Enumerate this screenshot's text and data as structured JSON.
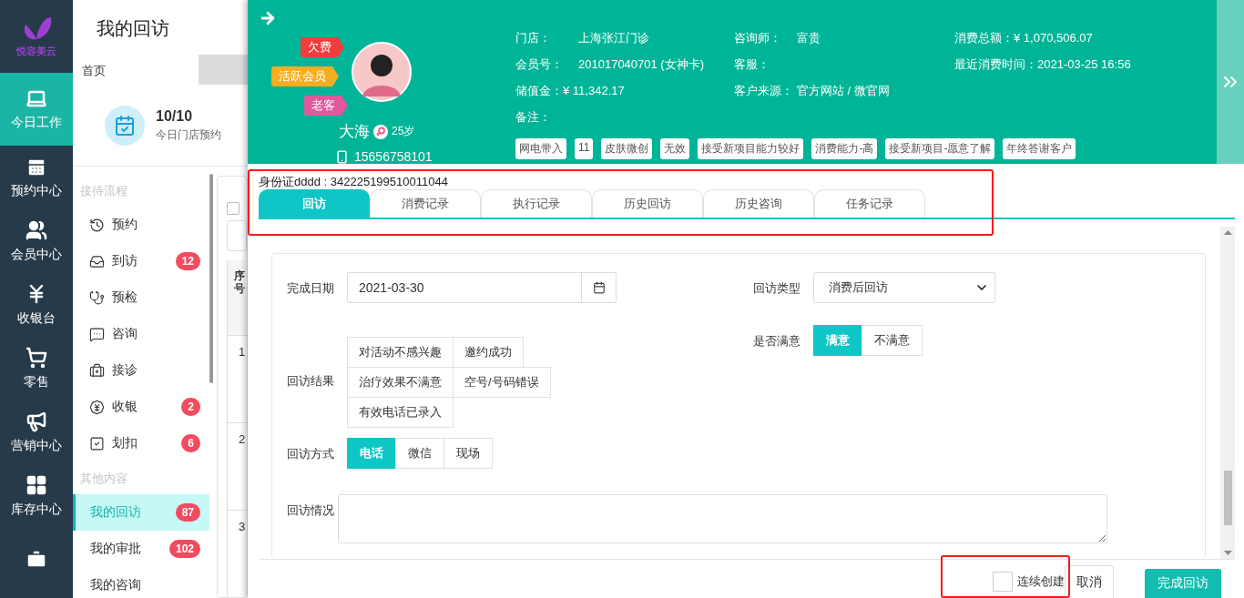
{
  "brand": {
    "name": "悦容美云"
  },
  "nav_rail": [
    {
      "label": "今日工作",
      "selected": true
    },
    {
      "label": "预约中心",
      "selected": false
    },
    {
      "label": "会员中心",
      "selected": false
    },
    {
      "label": "收银台",
      "selected": false
    },
    {
      "label": "零售",
      "selected": false
    },
    {
      "label": "营销中心",
      "selected": false
    },
    {
      "label": "库存中心",
      "selected": false
    },
    {
      "selected": false
    }
  ],
  "page_title": "我的回访",
  "page_tabs": [
    {
      "label": "首页",
      "selected": true
    }
  ],
  "stat": {
    "value": "10/10",
    "label": "今日门店预约"
  },
  "submenu": [
    {
      "title": "接待流程",
      "items": [
        {
          "label": "预约",
          "selected": false
        },
        {
          "label": "到访",
          "badge": "12",
          "selected": false
        },
        {
          "label": "预检",
          "selected": false
        },
        {
          "label": "咨询",
          "selected": false
        },
        {
          "label": "接诊",
          "selected": false
        },
        {
          "label": "收银",
          "badge": "2",
          "selected": false
        },
        {
          "label": "划扣",
          "badge": "6",
          "selected": false
        }
      ]
    },
    {
      "title": "其他内容",
      "items": [
        {
          "label": "我的回访",
          "badge": "87",
          "selected": true
        },
        {
          "label": "我的审批",
          "badge": "102",
          "selected": false
        },
        {
          "label": "我的咨询",
          "selected": false
        }
      ]
    }
  ],
  "background_table": {
    "checked": false,
    "header": "序号",
    "rows": [
      "1",
      "2",
      "3"
    ]
  },
  "customer": {
    "status_tags": [
      {
        "label": "欠费",
        "color": "#f23d3d"
      },
      {
        "label": "活跃会员",
        "color": "#f6ad1f"
      },
      {
        "label": "老客",
        "color": "#e2589d"
      }
    ],
    "name": "大海",
    "age": "25岁",
    "phone": "15656758101",
    "info_columns": [
      [
        {
          "label": "门店：",
          "value": "上海张江门诊"
        },
        {
          "label": "会员号：",
          "value": "201017040701 (女神卡)"
        },
        {
          "label": "储值金：",
          "value": "¥ 11,342.17"
        },
        {
          "label": "备注："
        }
      ],
      [
        {
          "label": "咨询师：",
          "value": "富贵"
        },
        {
          "label": "客服："
        },
        {
          "label": "客户来源：",
          "value": "官方网站 / 微官网"
        }
      ],
      [
        {
          "label": "消费总额：",
          "value": "¥ 1,070,506.07"
        },
        {
          "label": "最近消费时间：",
          "value": "2021-03-25 16:56"
        }
      ]
    ],
    "labels": [
      "网电带入",
      "11",
      "皮肤微创",
      "无效",
      "接受新项目能力较好",
      "消费能力-高",
      "接受新项目-愿意了解",
      "年终答谢客户"
    ]
  },
  "id_line": "身份证dddd : 342225199510011044",
  "tabs": [
    {
      "label": "回访",
      "selected": true
    },
    {
      "label": "消费记录",
      "selected": false
    },
    {
      "label": "执行记录",
      "selected": false
    },
    {
      "label": "历史回访",
      "selected": false
    },
    {
      "label": "历史咨询",
      "selected": false
    },
    {
      "label": "任务记录",
      "selected": false
    }
  ],
  "form": {
    "date": {
      "label": "完成日期",
      "value": "2021-03-30"
    },
    "type": {
      "label": "回访类型",
      "value": "消费后回访"
    },
    "result": {
      "label": "回访结果",
      "options": [
        {
          "label": "对活动不感兴趣",
          "selected": false
        },
        {
          "label": "邀约成功",
          "selected": false
        },
        {
          "label": "治疗效果不满意",
          "selected": false
        },
        {
          "label": "空号/号码错误",
          "selected": false
        },
        {
          "label": "有效电话已录入",
          "selected": false
        }
      ]
    },
    "satisfied": {
      "label": "是否满意",
      "options": [
        {
          "label": "满意",
          "selected": true
        },
        {
          "label": "不满意",
          "selected": false
        }
      ]
    },
    "method": {
      "label": "回访方式",
      "options": [
        {
          "label": "电话",
          "selected": true
        },
        {
          "label": "微信",
          "selected": false
        },
        {
          "label": "现场",
          "selected": false
        }
      ]
    },
    "notes": {
      "label": "回访情况"
    }
  },
  "footer": {
    "continuous": {
      "label": "连续创建",
      "checked": false
    },
    "cancel": "取消",
    "submit": "完成回访"
  }
}
